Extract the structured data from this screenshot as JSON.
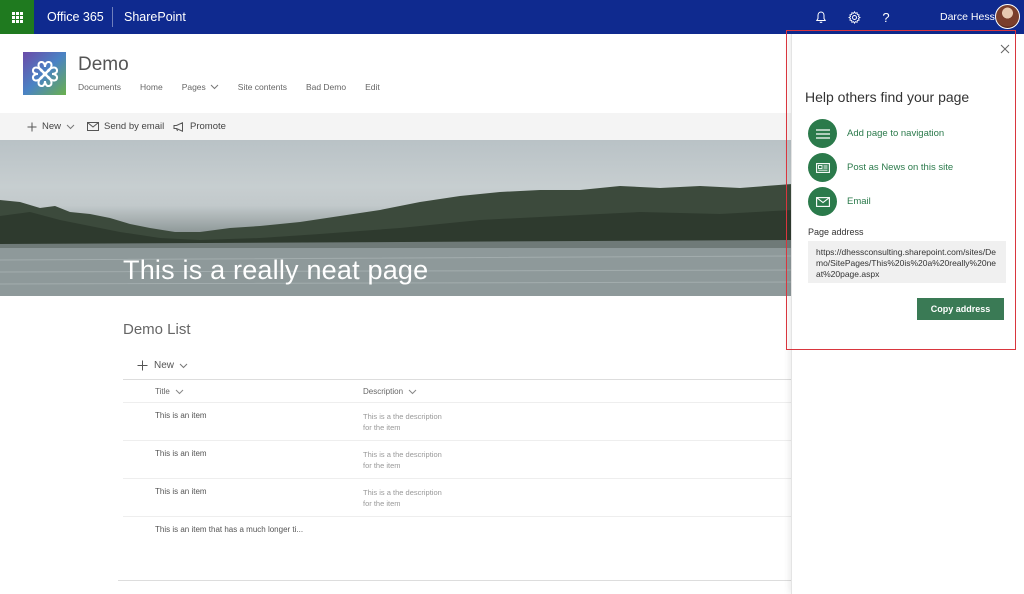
{
  "suitebar": {
    "brand": "Office 365",
    "app": "SharePoint",
    "user_name": "Darce Hess",
    "icons": [
      "app-launcher-icon",
      "bell-icon",
      "gear-icon",
      "help-icon"
    ]
  },
  "site": {
    "title": "Demo",
    "nav": [
      "Documents",
      "Home",
      "Pages",
      "Site contents",
      "Bad Demo",
      "Edit"
    ]
  },
  "commandbar": {
    "new_label": "New",
    "send_label": "Send by email",
    "promote_label": "Promote"
  },
  "hero": {
    "title": "This is a really neat page"
  },
  "list": {
    "title": "Demo List",
    "new_label": "New",
    "columns": [
      "Title",
      "Description"
    ],
    "rows": [
      {
        "title": "This is an item",
        "desc_line1": "This is a the description",
        "desc_line2": "for the item"
      },
      {
        "title": "This is an item",
        "desc_line1": "This is a the description",
        "desc_line2": "for the item"
      },
      {
        "title": "This is an item",
        "desc_line1": "This is a the description",
        "desc_line2": "for the item"
      },
      {
        "title": "This is an item that has a much longer ti...",
        "desc_line1": "",
        "desc_line2": ""
      }
    ]
  },
  "panel": {
    "title": "Help others find your page",
    "actions": [
      {
        "label": "Add page to navigation",
        "icon": "menu-lines-icon"
      },
      {
        "label": "Post as News on this site",
        "icon": "news-icon"
      },
      {
        "label": "Email",
        "icon": "mail-icon"
      }
    ],
    "address_label": "Page address",
    "address": "https://dhessconsulting.sharepoint.com/sites/Demo/SitePages/This%20is%20a%20really%20neat%20page.aspx",
    "copy_button": "Copy address"
  },
  "colors": {
    "suitebar": "#0f2a8f",
    "waffle": "#1f7a1f",
    "accent_green": "#2b7a4b",
    "highlight_red": "#d9363e"
  }
}
